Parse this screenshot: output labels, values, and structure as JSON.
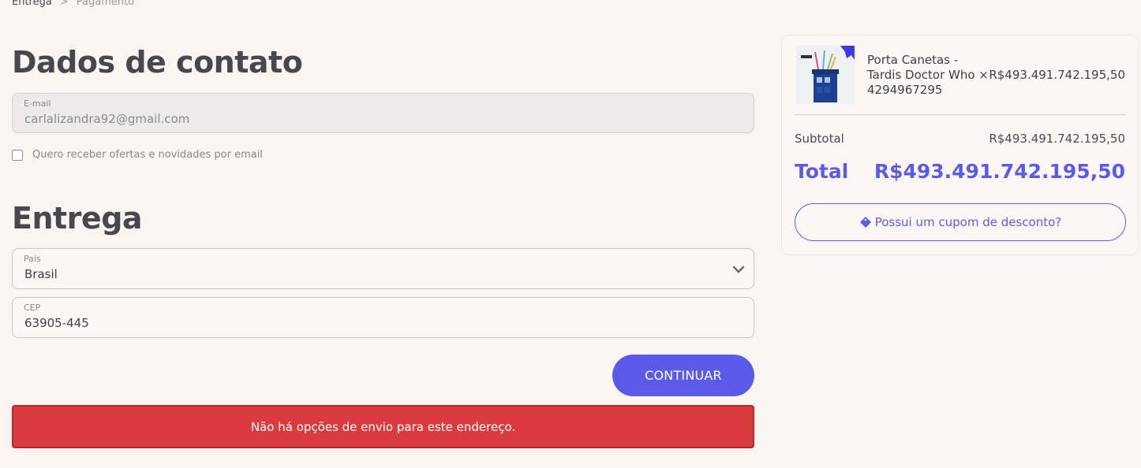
{
  "breadcrumb": {
    "current": "Entrega",
    "separator": ">",
    "next": "Pagamento"
  },
  "contact": {
    "title": "Dados de contato",
    "email_label": "E-mail",
    "email_value": "carlalizandra92@gmail.com",
    "newsletter_label": "Quero receber ofertas e novidades por email"
  },
  "delivery": {
    "title": "Entrega",
    "country_label": "País",
    "country_value": "Brasil",
    "cep_label": "CEP",
    "cep_value": "63905-445",
    "continue_label": "CONTINUAR",
    "error_message": "Não há opções de envio para este endereço."
  },
  "summary": {
    "product_name": "Porta Canetas - Tardis Doctor Who ×",
    "product_quantity": "4294967295",
    "product_price": "R$493.491.742.195,50",
    "subtotal_label": "Subtotal",
    "subtotal_value": "R$493.491.742.195,50",
    "total_label": "Total",
    "total_value": "R$493.491.742.195,50",
    "coupon_label": "Possui um cupom de desconto?"
  },
  "colors": {
    "accent": "#5a5be8",
    "error": "#d93b3e",
    "background": "#fbf5f2"
  }
}
